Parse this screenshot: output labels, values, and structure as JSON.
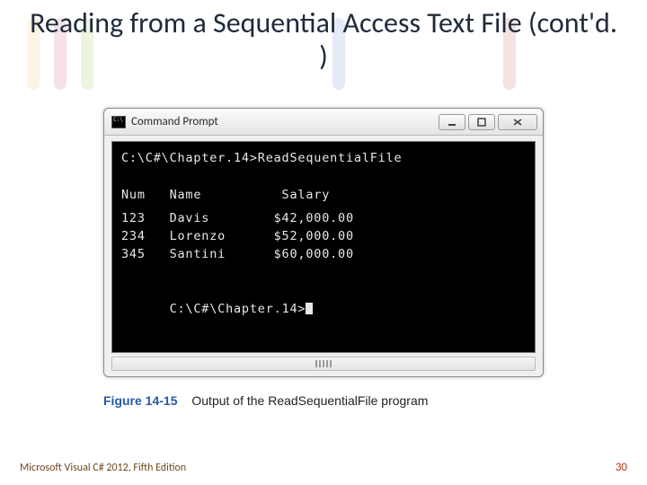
{
  "title": "Reading from a Sequential Access Text File (cont'd. )",
  "window": {
    "title": "Command Prompt",
    "prompt1": "C:\\C#\\Chapter.14>ReadSequentialFile",
    "header": "Num   Name          Salary",
    "rows": [
      "123   Davis        $42,000.00",
      "234   Lorenzo      $52,000.00",
      "345   Santini      $60,000.00"
    ],
    "prompt2": "C:\\C#\\Chapter.14>"
  },
  "caption": {
    "label": "Figure 14-15",
    "text": "Output of the ReadSequentialFile program"
  },
  "footer": {
    "left": "Microsoft Visual C# 2012, Fifth Edition",
    "page": "30"
  }
}
